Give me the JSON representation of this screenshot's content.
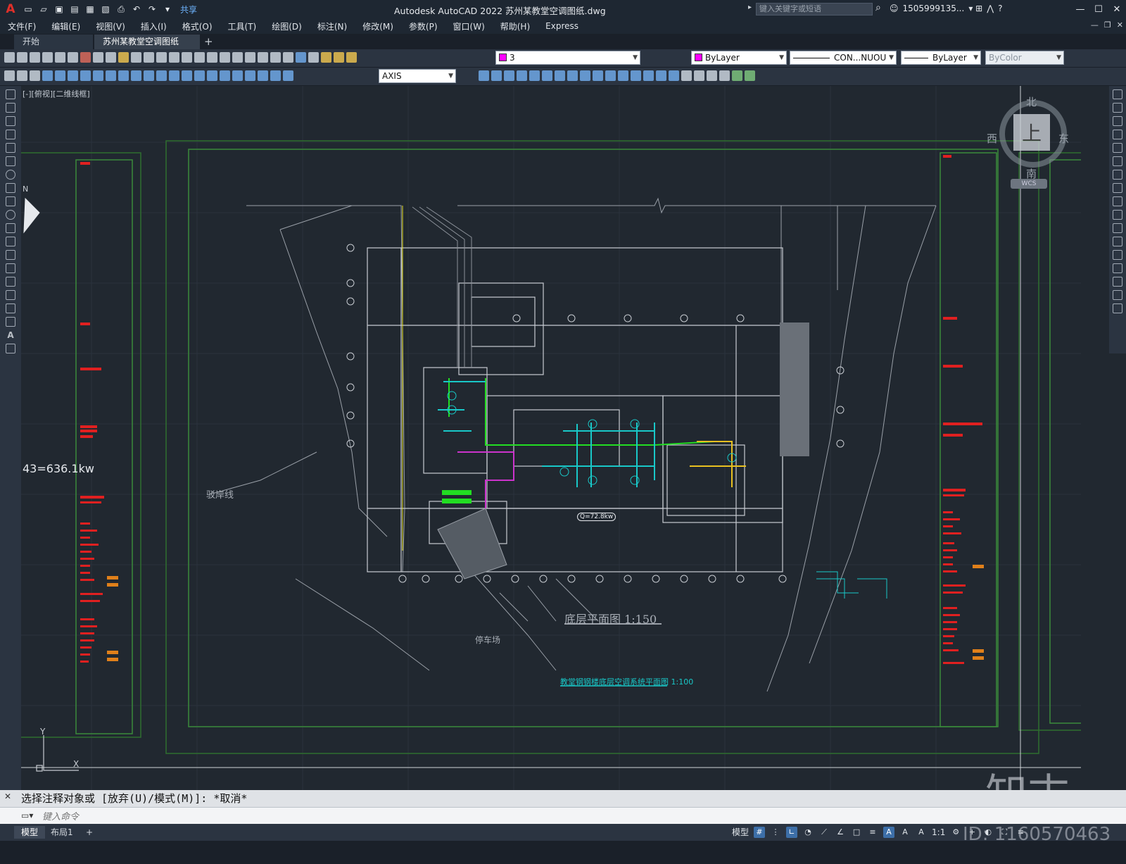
{
  "app": {
    "title": "Autodesk AutoCAD 2022    苏州某教堂空调图纸.dwg",
    "logo": "A",
    "share_label": "共享"
  },
  "search": {
    "placeholder": "键入关键字或短语"
  },
  "user": {
    "name": "1505999135...",
    "cart": "cart-icon",
    "help": "?"
  },
  "menu": {
    "items": [
      "文件(F)",
      "编辑(E)",
      "视图(V)",
      "插入(I)",
      "格式(O)",
      "工具(T)",
      "绘图(D)",
      "标注(N)",
      "修改(M)",
      "参数(P)",
      "窗口(W)",
      "帮助(H)",
      "Express"
    ]
  },
  "tabs": {
    "start": "开始",
    "active": "苏州某教堂空调图纸*",
    "close": "×",
    "add": "+"
  },
  "properties": {
    "layer_value": "3",
    "color_value": "ByLayer",
    "linetype_value": "CON...NUOU",
    "lineweight_value": "ByLayer",
    "plotstyle_value": "ByColor",
    "dimstyle_value": "AXIS"
  },
  "viewport": {
    "label": "[-][俯视][二维线框]"
  },
  "viewcube": {
    "north": "北",
    "south": "南",
    "east": "东",
    "west": "西",
    "top": "上",
    "wcs": "WCS"
  },
  "drawing": {
    "plan_title": "底层平面图  1:150",
    "hvac_title": "教堂钢钢楼底层空调系统平面图  1:100",
    "load_text": "43=636.1kw",
    "load_small": "Q=72.8kw",
    "bank_line": "驳岸线",
    "parking": "停车场",
    "north_label": "N",
    "y_axis": "Y",
    "x_axis": "X"
  },
  "command": {
    "history": "选择注释对象或 [放弃(U)/模式(M)]: *取消*",
    "placeholder": "键入命令"
  },
  "status": {
    "model_tab": "模型",
    "layout_tab": "布局1",
    "model_button": "模型",
    "scale": "1:1"
  },
  "watermark": {
    "brand": "知末",
    "id": "ID: 1160570463"
  }
}
